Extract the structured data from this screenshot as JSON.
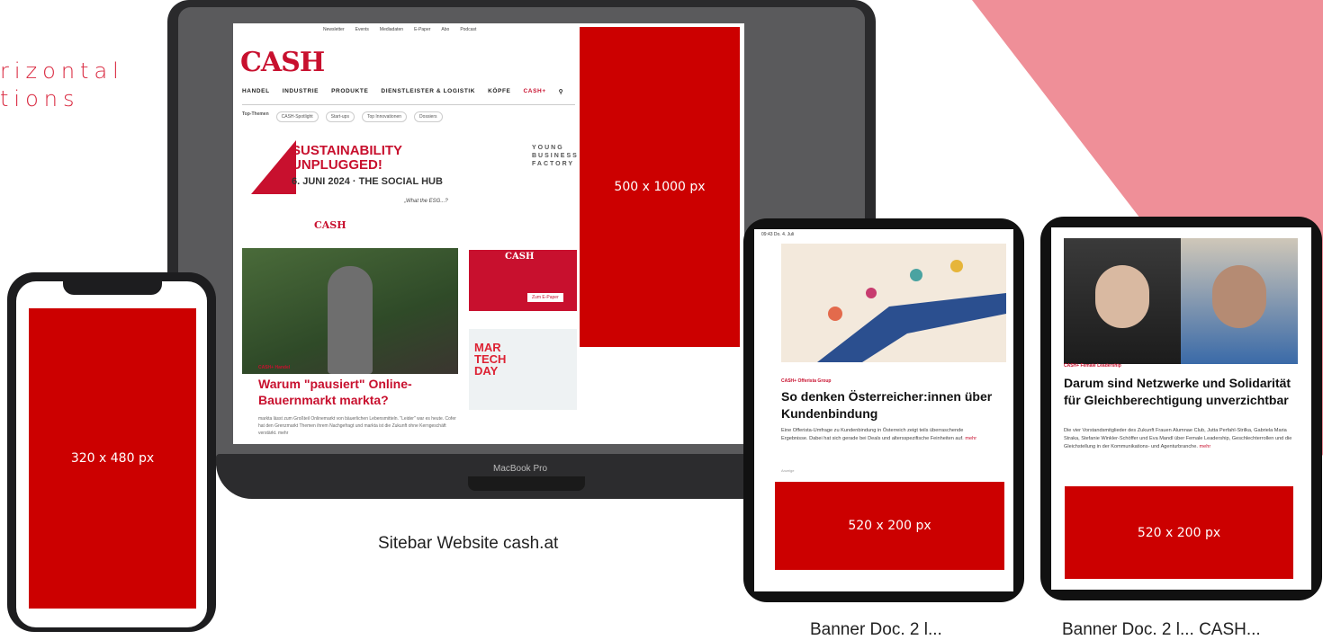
{
  "colors": {
    "brand_red": "#cc0000",
    "accent_pink": "#ef8f98",
    "cash_red": "#c8102e"
  },
  "side_heading": {
    "line1": "rizontal",
    "line2": "tions"
  },
  "laptop": {
    "brand": "MacBook Pro",
    "caption": "Sitebar Website cash.at",
    "ad_size": "500 x 1000 px",
    "site": {
      "topbar": [
        "Newsletter",
        "Events",
        "Mediadaten",
        "E-Paper",
        "Abo",
        "Podcast"
      ],
      "logo": "CASH",
      "nav": [
        "HANDEL",
        "INDUSTRIE",
        "PRODUKTE",
        "DIENSTLEISTER & LOGISTIK",
        "KÖPFE",
        "CASH+"
      ],
      "tags": [
        "Top-Themen",
        "CASH-Spotlight",
        "Start-ups",
        "Top Innovationen",
        "Dossiers"
      ],
      "banner": {
        "title1": "SUSTAINABILITY",
        "title2": "UNPLUGGED!",
        "date": "6. JUNI 2024 · THE SOCIAL HUB",
        "quote": "„What the ESG...?",
        "ybf": [
          "YOUNG",
          "BUSINESS",
          "FACTORY"
        ],
        "brand": "CASH"
      },
      "article": {
        "kicker": "CASH+ Handel",
        "headline": "Warum \"pausiert\" Online-Bauernmarkt markta?",
        "snippet": "markta lässt zum Großteil Onlinemarkt von bäuerlichen Lebensmitteln. \"Leider\" war es heute. Cofer hat den Grenzmarkt Themen ihrem Nachgefragt und markta ist die Zukunft ohne Kerngeschäft verstärkt. mehr"
      },
      "ad_square": {
        "logo": "CASH",
        "cta": "Zum E-Paper"
      },
      "ad_mtd": {
        "line1": "MAR",
        "line2": "TECH",
        "line3": "DAY"
      }
    }
  },
  "phone": {
    "ad_size": "320 x 480 px"
  },
  "tablet1": {
    "status": "09:43  Do. 4. Juli",
    "kicker": "CASH+ Offerista Group",
    "headline": "So denken Österreicher:innen über Kundenbindung",
    "body": "Eine Offerista-Umfrage zu Kundenbindung in Österreich zeigt teils überraschende Ergebnisse. Dabei hat sich gerade bei Deals und altersspezifische Feinheiten auf.",
    "more": "mehr",
    "ad_label": "Anzeige",
    "ad_size": "520 x 200 px",
    "caption": "Banner Doc. 2 l..."
  },
  "tablet2": {
    "kicker": "CASH+ Female Leadership",
    "headline": "Darum sind Netzwerke und Solidarität für Gleichberechtigung unverzichtbar",
    "body": "Die vier Vorstandsmitglieder des Zukunft Frauen Alumnae Club, Jutta Perfahl-Strilka, Gabriela Maria Straka, Stefanie Winkler-Schöffer und Eva Mandl über Female Leadership, Geschlechterrollen und die Gleichstellung in der Kommunikations- und Agenturbranche.",
    "more": "mehr",
    "ad_size": "520 x 200 px",
    "caption": "Banner Doc. 2 l... CASH..."
  }
}
